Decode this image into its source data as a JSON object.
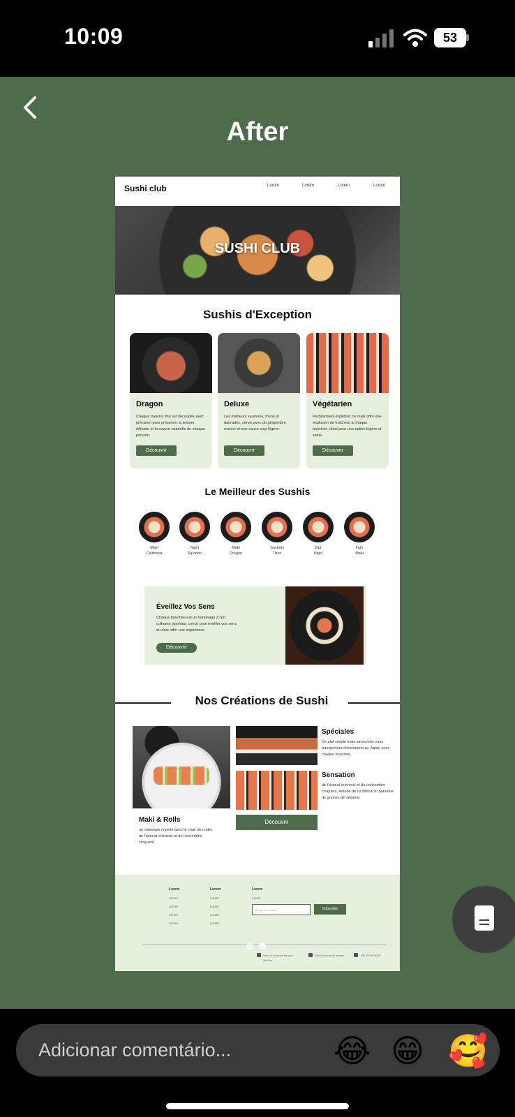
{
  "status_bar": {
    "time": "10:09",
    "battery": "53"
  },
  "story": {
    "title": "After",
    "mockup": {
      "logo": "Sushi club",
      "nav_links": [
        "Lorem",
        "Lorem",
        "Lorem",
        "Lorem"
      ],
      "hero_title": "SUSHI CLUB",
      "section1_title": "Sushis d'Exception",
      "cards": [
        {
          "title": "Dragon",
          "text": "Chaque tranche fine est découpée avec précision pour préserver la texture délicate et la saveur naturelle de chaque poisson.",
          "button": "Découvrir"
        },
        {
          "title": "Deluxe",
          "text": "Les meilleurs saumons, thons et daurades, servis avec du gingembre mariné et une sauce soja légère.",
          "button": "Découvrir"
        },
        {
          "title": "Végétarien",
          "text": "Parfaitement équilibré, ce maki offre une explosion de fraîcheur à chaque bouchée, idéal pour une option légère et saine.",
          "button": "Découvrir"
        }
      ],
      "section2_title": "Le Meilleur des Sushis",
      "rounds": [
        {
          "line1": "Maki",
          "line2": "California"
        },
        {
          "line1": "Nigiri",
          "line2": "Saumon"
        },
        {
          "line1": "Maki",
          "line2": "Dragon"
        },
        {
          "line1": "Sashimi",
          "line2": "Thon"
        },
        {
          "line1": "Ebi",
          "line2": "Nigiri"
        },
        {
          "line1": "Futo",
          "line2": "Maki"
        }
      ],
      "promo": {
        "title": "Éveillez Vos Sens",
        "text": "Chaque bouchée est un hommage à l'art culinaire japonais, conçu pour éveiller vos sens et vous offrir une expérience",
        "button": "Découvrir"
      },
      "section3_title": "Nos Créations de Sushi",
      "maki": {
        "title": "Maki & Rolls",
        "text": "un classique revisité avec la chair de crabe, de l'avocat crémeux et du concombre croquant."
      },
      "speciales": {
        "title": "Spéciales",
        "text": "Ce plat simple mais savoureux vous transportera directement au Japon avec chaque bouchée."
      },
      "sensation": {
        "title": "Sensation",
        "text": "de l'avocat crémeux et du concombre croquant, enrobé de riz délicat et parsemé de graines de sésame."
      },
      "creations_button": "Découvrir",
      "footer": {
        "col_heads": [
          "Lorem",
          "Lorem",
          "Lorem"
        ],
        "col1": [
          "Lorem",
          "Lorem",
          "Lorem",
          "Lorem"
        ],
        "col2": [
          "Lorem",
          "Lorem",
          "Lorem",
          "Lorem"
        ],
        "col3": [
          "Lorem"
        ],
        "email_placeholder": "Email Your Email",
        "subscribe": "Subscribe",
        "info1": "Sed do eiusmod tempor",
        "info1b": "Sed do",
        "info2": "Sed do eiusmod tempor",
        "info3": "+00 00000 0000"
      }
    }
  },
  "bottom_bar": {
    "comment_placeholder": "Adicionar comentário...",
    "reactions": [
      "😂",
      "😁",
      "🥰"
    ]
  }
}
